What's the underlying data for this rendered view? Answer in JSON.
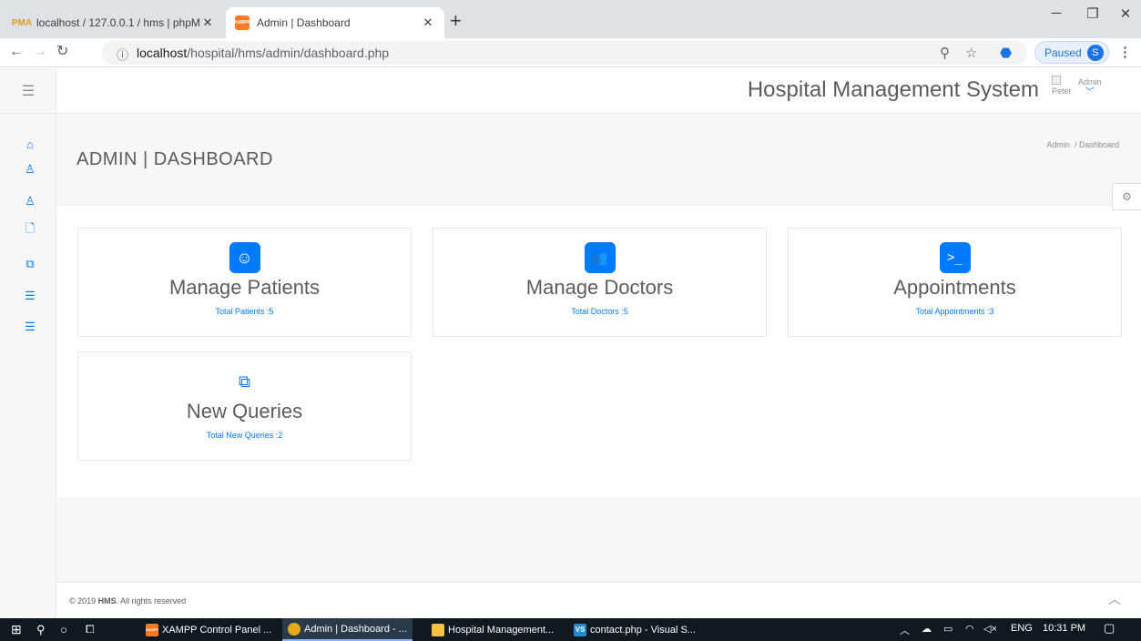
{
  "browser": {
    "tabs": [
      {
        "title": "localhost / 127.0.0.1 / hms | phpM",
        "favicon": "phpmyadmin-icon",
        "icon_text": "PMA"
      },
      {
        "title": "Admin | Dashboard",
        "favicon": "xampp-icon",
        "icon_text": "XAMPP"
      }
    ],
    "new_tab": "+",
    "close": "✕",
    "url_host": "localhost",
    "url_path": "/hospital/hms/admin/dashboard.php",
    "paused_label": "Paused",
    "profile_initial": "S"
  },
  "app": {
    "title": "Hospital Management System",
    "user_image_alt": "Peter",
    "user_label": "Admin",
    "sidebar": [
      {
        "name": "home-icon",
        "glyph": "⌂"
      },
      {
        "name": "user-icon",
        "glyph": "♙"
      },
      {
        "name": "user-icon-2",
        "glyph": "♙"
      },
      {
        "name": "file-icon",
        "glyph": "🗋"
      },
      {
        "name": "files-icon",
        "glyph": "⧉"
      },
      {
        "name": "list-icon",
        "glyph": "☰"
      },
      {
        "name": "list-icon-2",
        "glyph": "☰"
      }
    ]
  },
  "page": {
    "title": "ADMIN | DASHBOARD",
    "breadcrumb_root": "Admin",
    "breadcrumb_sep": "/",
    "breadcrumb_current": "Dashboard"
  },
  "cards": [
    {
      "title": "Manage Patients",
      "subtitle": "Total Patients :5",
      "icon": "smile-icon"
    },
    {
      "title": "Manage Doctors",
      "subtitle": "Total Doctors :5",
      "icon": "users-icon"
    },
    {
      "title": "Appointments",
      "subtitle": "Total Appointments :3",
      "icon": "terminal-icon"
    },
    {
      "title": "New Queries",
      "subtitle": "Total New Queries :2",
      "icon": "files-icon"
    }
  ],
  "footer": {
    "copy_prefix": "© 2019 ",
    "copy_brand": "HMS",
    "copy_suffix": ". All rights reserved"
  },
  "taskbar": {
    "apps": [
      {
        "label": "XAMPP Control Panel ...",
        "icon": "xampp-icon",
        "icon_text": "XAMPP"
      },
      {
        "label": "Admin | Dashboard - ...",
        "icon": "chrome-icon",
        "icon_text": ""
      },
      {
        "label": "Hospital Management...",
        "icon": "folder-icon",
        "icon_text": ""
      },
      {
        "label": "contact.php - Visual S...",
        "icon": "vscode-icon",
        "icon_text": "VS"
      }
    ],
    "lang": "ENG",
    "time": "10:31 PM"
  },
  "colors": {
    "accent": "#007aff",
    "sidebar_bg": "#f7f7f8",
    "taskbar_bg": "#101820"
  }
}
